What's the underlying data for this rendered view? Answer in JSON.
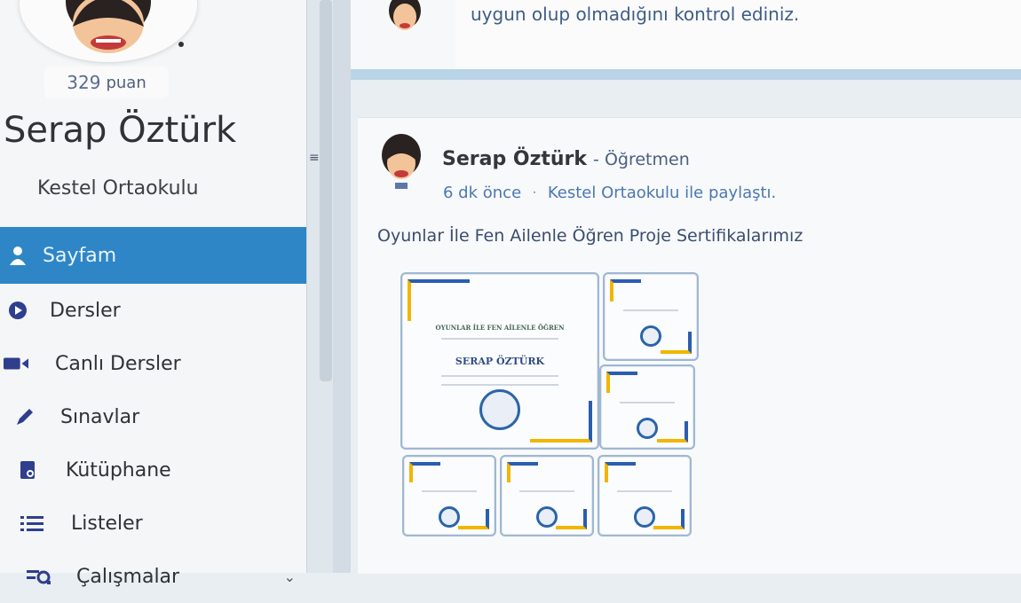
{
  "profile": {
    "points_value": "329",
    "points_unit": "puan",
    "name": "Serap Öztürk",
    "school": "Kestel Ortaokulu"
  },
  "sidebar": {
    "items": [
      {
        "label": "Sayfam",
        "icon": "user-icon",
        "active": true
      },
      {
        "label": "Dersler",
        "icon": "play-circle-icon"
      },
      {
        "label": "Canlı Dersler",
        "icon": "video-camera-icon"
      },
      {
        "label": "Sınavlar",
        "icon": "pencil-icon"
      },
      {
        "label": "Kütüphane",
        "icon": "library-icon"
      },
      {
        "label": "Listeler",
        "icon": "list-icon"
      },
      {
        "label": "Çalışmalar",
        "icon": "works-icon"
      }
    ]
  },
  "feed": {
    "previous_post_text": "uygun olup olmadığını kontrol ediniz.",
    "post": {
      "author": "Serap Öztürk",
      "role": "- Öğretmen",
      "time": "6 dk önce",
      "shared_with": "Kestel Ortaokulu ile paylaştı.",
      "text": "Oyunlar İle Fen Ailenle Öğren Proje Sertifikalarımız",
      "certificate": {
        "title": "OYUNLAR İLE FEN AİLENLE ÖĞREN",
        "recipient": "SERAP ÖZTÜRK"
      }
    }
  },
  "colors": {
    "accent": "#2e86c7",
    "link": "#4a78b3",
    "cert_blue": "#2a5db0",
    "cert_gold": "#f2b500"
  }
}
